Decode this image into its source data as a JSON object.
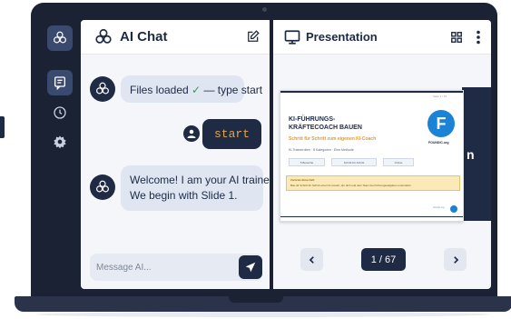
{
  "chat": {
    "title": "AI Chat",
    "messages": {
      "ai_status_prefix": "Files loaded ",
      "ai_status_check": "✓",
      "ai_status_suffix": " — type start",
      "user_command": "start",
      "ai_welcome_line1": "Welcome! I am your AI trainer.",
      "ai_welcome_line2": "We begin with Slide 1."
    },
    "input": {
      "placeholder": "Message AI..."
    }
  },
  "presentation": {
    "title": "Presentation",
    "page_indicator": "1 / 67",
    "slide": {
      "heading_line1": "KI-FÜHRUNGS-",
      "heading_line2": "KRÄFTECOACH BAUEN",
      "subheading": "Schritt für Schritt zum eigenen KI-Coach",
      "small_line": "KI-Trainerrollen · 8 Kategorien · Eine Methode",
      "logo_letter": "F",
      "logo_text": "FOUNDIC.org",
      "tags": [
        "5 Bereiche",
        "Schritt-für-Schritt",
        "Online"
      ],
      "note_title": "Zentrale Botschaft",
      "note_text": "Bau dir Schritt für Schritt einen KI-Coach, der dich und dein Team bei Führungsaufgaben unterstützt.",
      "page_small": "Seite 1 / 67",
      "footer_small": "foundic.org",
      "back_slide_text": "n"
    }
  },
  "colors": {
    "navy": "#1f2b44",
    "accent_orange": "#e8a43a",
    "brand_blue": "#1a83d6",
    "bubble": "#dfe6f2",
    "check_green": "#2aa54a"
  },
  "icons": {
    "rail": [
      "openai-logo-icon",
      "chat-icon",
      "clock-icon",
      "gear-icon"
    ],
    "chat_header": [
      "openai-logo-icon",
      "edit-icon"
    ],
    "presentation_header": [
      "monitor-icon",
      "grid-icon",
      "more-vertical-icon"
    ],
    "navigation": [
      "chevron-left-icon",
      "chevron-right-icon"
    ],
    "send": "send-icon"
  }
}
